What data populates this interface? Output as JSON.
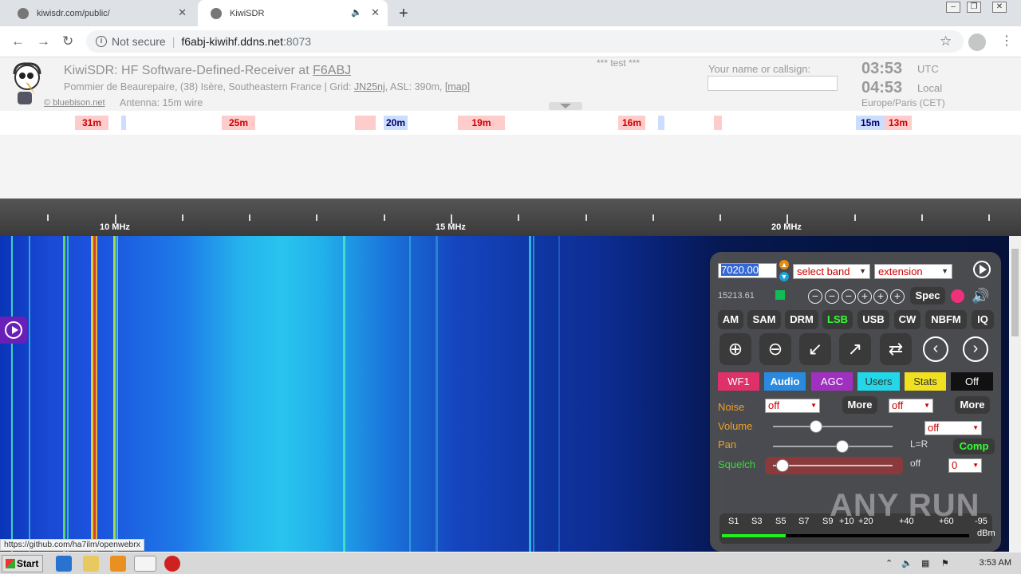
{
  "browser": {
    "tabs": [
      {
        "title": "kiwisdr.com/public/"
      },
      {
        "title": "KiwiSDR"
      }
    ],
    "address": {
      "security": "Not secure",
      "host": "f6abj-kiwihf.ddns.net",
      "port": ":8073"
    },
    "status_link": "https://github.com/ha7ilm/openwebrx"
  },
  "kiwi": {
    "title_prefix": "KiwiSDR: HF Software-Defined-Receiver at",
    "callsign": "F6ABJ",
    "location": "Pommier de Beaurepaire, (38) Isère, Southeastern France | Grid:",
    "grid": "JN25nj",
    "asl": ", ASL: 390m,",
    "map": "[map]",
    "credit": "© bluebison.net",
    "antenna": "Antenna: 15m wire",
    "test_msg": "*** test ***",
    "name_label": "Your name or callsign:",
    "utc_time": "03:53",
    "utc_label": "UTC",
    "local_time": "04:53",
    "local_label": "Local",
    "timezone": "Europe/Paris (CET)"
  },
  "bands": [
    {
      "label": "31m",
      "color": "red"
    },
    {
      "label": "",
      "color": "blue"
    },
    {
      "label": "25m",
      "color": "red"
    },
    {
      "label": "",
      "color": "red"
    },
    {
      "label": "20m",
      "color": "blue"
    },
    {
      "label": "19m",
      "color": "red"
    },
    {
      "label": "16m",
      "color": "red"
    },
    {
      "label": "",
      "color": "blue"
    },
    {
      "label": "",
      "color": "red"
    },
    {
      "label": "15m",
      "color": "blue"
    },
    {
      "label": "13m",
      "color": "red"
    }
  ],
  "scale": {
    "labels": [
      "10 MHz",
      "15 MHz",
      "20 MHz"
    ]
  },
  "panel": {
    "frequency": "7020.00",
    "band_select": "select band",
    "extension_select": "extension",
    "signal_freq": "15213.61",
    "spec": "Spec",
    "modes": [
      "AM",
      "SAM",
      "DRM",
      "LSB",
      "USB",
      "CW",
      "NBFM",
      "IQ"
    ],
    "active_mode": "LSB",
    "tabs": [
      "WF1",
      "Audio",
      "AGC",
      "Users",
      "Stats",
      "Off"
    ],
    "noise_label": "Noise",
    "noise_value": "off",
    "noise2_value": "off",
    "more": "More",
    "volume_label": "Volume",
    "volume_value": "off",
    "volume_level": 0.28,
    "pan_label": "Pan",
    "pan_value": "L=R",
    "pan_level": 0.5,
    "comp": "Comp",
    "squelch_label": "Squelch",
    "squelch_value": "off",
    "squelch_select": "0",
    "squelch_level": 0.0,
    "smeter_labels": [
      "S1",
      "S3",
      "S5",
      "S7",
      "S9",
      "+10",
      "+20",
      "+40",
      "+60"
    ],
    "smeter_value": "-95",
    "smeter_unit": "dBm"
  },
  "watermark": "ANY RUN",
  "taskbar": {
    "start": "Start",
    "time": "3:53 AM"
  }
}
